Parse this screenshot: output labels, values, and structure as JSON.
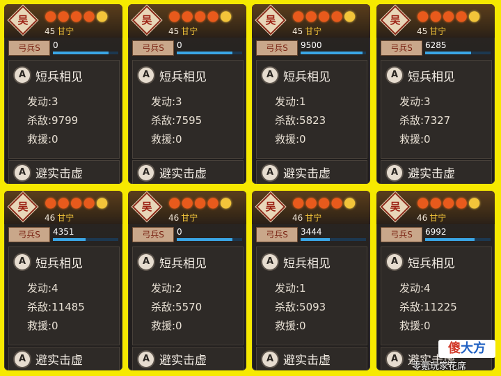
{
  "panels": [
    {
      "seal": "吴",
      "level": "45",
      "name": "甘宁",
      "troop_label": "弓兵S",
      "troop_count": "0",
      "troop_fill": 0.85,
      "skill1": "短兵相见",
      "skill_letter": "A",
      "activate": "发动:3",
      "kills": "杀敌:9799",
      "rescue": "救援:0",
      "skill2": "避实击虚"
    },
    {
      "seal": "吴",
      "level": "45",
      "name": "甘宁",
      "troop_label": "弓兵S",
      "troop_count": "0",
      "troop_fill": 0.85,
      "skill1": "短兵相见",
      "skill_letter": "A",
      "activate": "发动:3",
      "kills": "杀敌:7595",
      "rescue": "救援:0",
      "skill2": "避实击虚"
    },
    {
      "seal": "吴",
      "level": "45",
      "name": "甘宁",
      "troop_label": "弓兵S",
      "troop_count": "9500",
      "troop_fill": 0.95,
      "skill1": "短兵相见",
      "skill_letter": "A",
      "activate": "发动:1",
      "kills": "杀敌:5823",
      "rescue": "救援:0",
      "skill2": "避实击虚"
    },
    {
      "seal": "吴",
      "level": "45",
      "name": "甘宁",
      "troop_label": "弓兵S",
      "troop_count": "6285",
      "troop_fill": 0.7,
      "skill1": "短兵相见",
      "skill_letter": "A",
      "activate": "发动:3",
      "kills": "杀敌:7327",
      "rescue": "救援:0",
      "skill2": "避实击虚"
    },
    {
      "seal": "吴",
      "level": "46",
      "name": "甘宁",
      "troop_label": "弓兵S",
      "troop_count": "4351",
      "troop_fill": 0.5,
      "skill1": "短兵相见",
      "skill_letter": "A",
      "activate": "发动:4",
      "kills": "杀敌:11485",
      "rescue": "救援:0",
      "skill2": "避实击虚"
    },
    {
      "seal": "吴",
      "level": "46",
      "name": "甘宁",
      "troop_label": "弓兵S",
      "troop_count": "0",
      "troop_fill": 0.85,
      "skill1": "短兵相见",
      "skill_letter": "A",
      "activate": "发动:2",
      "kills": "杀敌:5570",
      "rescue": "救援:0",
      "skill2": "避实击虚"
    },
    {
      "seal": "吴",
      "level": "46",
      "name": "甘宁",
      "troop_label": "弓兵S",
      "troop_count": "3444",
      "troop_fill": 0.45,
      "skill1": "短兵相见",
      "skill_letter": "A",
      "activate": "发动:1",
      "kills": "杀敌:5093",
      "rescue": "救援:0",
      "skill2": "避实击虚"
    },
    {
      "seal": "吴",
      "level": "46",
      "name": "甘宁",
      "troop_label": "弓兵S",
      "troop_count": "6992",
      "troop_fill": 0.75,
      "skill1": "短兵相见",
      "skill_letter": "A",
      "activate": "发动:4",
      "kills": "杀敌:11225",
      "rescue": "救援:0",
      "skill2": "避实击虚"
    }
  ],
  "watermark": {
    "text_a": "傻",
    "text_b": "大方"
  },
  "footer": "零氪玩家花席",
  "colors": {
    "background": "#f6e900",
    "orange_dot": "#e85a1c",
    "gold_dot": "#f2c43a",
    "bar": "#3aa6e6"
  },
  "icons": {
    "dot": "fire-drop-icon",
    "seal": "faction-seal-icon"
  }
}
